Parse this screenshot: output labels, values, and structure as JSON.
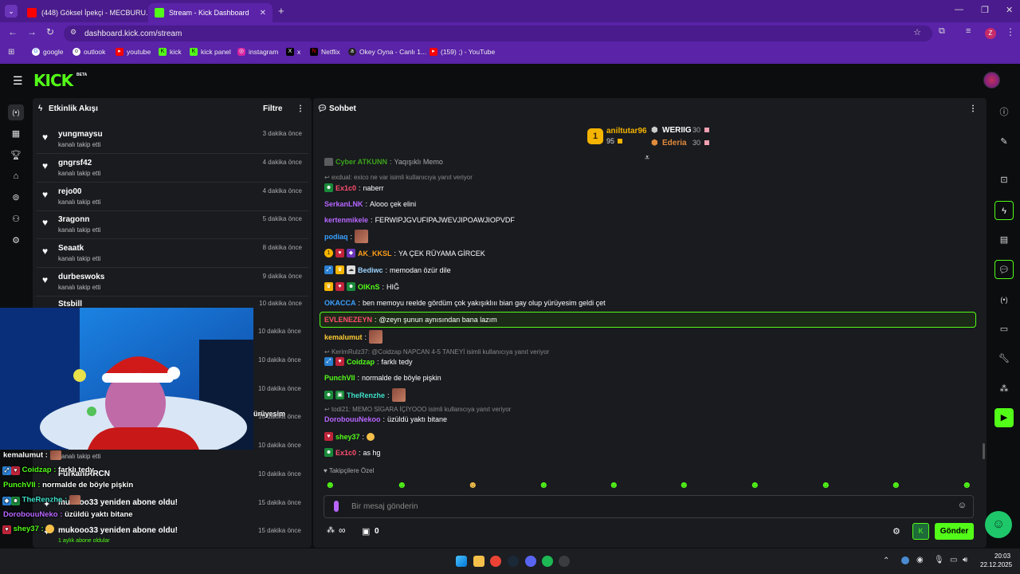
{
  "browser": {
    "tabs": [
      {
        "title": "(448) Göksel İpekçi - MECBURU..."
      },
      {
        "title": "Stream - Kick Dashboard"
      }
    ],
    "new_tab": "+",
    "url": "dashboard.kick.com/stream",
    "profile_letter": "Z",
    "bookmarks": [
      "google",
      "outlook",
      "youtube",
      "kick",
      "kick panel",
      "instagram",
      "x",
      "Netflix",
      "Okey Oyna - Canlı 1...",
      "(159) ;) - YouTube"
    ]
  },
  "kick": {
    "logo": "KICK",
    "beta": "BETA"
  },
  "activity": {
    "title": "Etkinlik Akışı",
    "filter": "Filtre",
    "items": [
      {
        "name": "yungmaysu",
        "action": "kanalı takip etti",
        "time": "3 dakika önce"
      },
      {
        "name": "gngrsf42",
        "action": "kanalı takip etti",
        "time": "4 dakika önce"
      },
      {
        "name": "rejo00",
        "action": "kanalı takip etti",
        "time": "4 dakika önce"
      },
      {
        "name": "3ragonn",
        "action": "kanalı takip etti",
        "time": "5 dakika önce"
      },
      {
        "name": "Seaatk",
        "action": "kanalı takip etti",
        "time": "8 dakika önce"
      },
      {
        "name": "durbeswoks",
        "action": "kanalı takip etti",
        "time": "9 dakika önce"
      },
      {
        "name": "Stsbill",
        "action": "",
        "time": "10 dakika önce"
      }
    ],
    "hidden_times": [
      "10 dakika önce",
      "10 dakika önce",
      "10 dakika önce",
      "10 dakika önce",
      "10 dakika önce"
    ],
    "partial_text": "ürüyesim",
    "follow_tail": "kanalı takip etti",
    "furkan": "FurkanIARCN",
    "subs": [
      {
        "name": "mukooo33 yeniden abone oldu!",
        "time": "15 dakika önce"
      },
      {
        "name": "mukooo33 yeniden abone oldu!",
        "time": "15 dakika önce"
      }
    ],
    "sub_tail": "1 aylık abone oldular"
  },
  "overlay_chat": [
    {
      "user": "kemalumut",
      "text": "",
      "color": "#ffffff"
    },
    {
      "user": "Coidzap",
      "text": "farklı tedy",
      "color": "#53fc18"
    },
    {
      "user": "PunchVII",
      "text": "normalde de böyle pişkin",
      "color": "#53fc18"
    },
    {
      "user": "TheRenzhe",
      "text": "",
      "color": "#3ee0c8"
    },
    {
      "user": "DorobouuNeko",
      "text": "üzüldü yaktı bitane",
      "color": "#b866ff"
    },
    {
      "user": "shey37",
      "text": "",
      "color": "#53fc18"
    }
  ],
  "chat": {
    "title": "Sohbet",
    "leaderboard": {
      "first": {
        "rank": "1",
        "name": "aniltutar96",
        "points": "95"
      },
      "second": {
        "name": "WERIIG",
        "points": "30"
      },
      "third": {
        "name": "Ederia",
        "points": "30"
      }
    },
    "messages": [
      {
        "user": "Cyber ATKUNN",
        "text": "Yaqışıklı Memo",
        "color": "#53fc18",
        "reply": ""
      },
      {
        "user": "Ex1c0",
        "text": "naberr",
        "color": "#ff4d6d",
        "reply": "exdual: exico ne var isimli kullanıcıya yanıt veriyor"
      },
      {
        "user": "SerkanLNK",
        "text": "Alooo çek elini",
        "color": "#b866ff",
        "reply": ""
      },
      {
        "user": "kertenmikele",
        "text": "FERWIPJGVUFIPAJWEVJIPOAWJIOPVDF",
        "color": "#b866ff",
        "reply": ""
      },
      {
        "user": "podiaq",
        "text": "",
        "color": "#3aa0ff",
        "reply": ""
      },
      {
        "user": "AK_KKSL",
        "text": "YA ÇEK RÜYAMA GİRCEK",
        "color": "#ff9f1a",
        "reply": ""
      },
      {
        "user": "Bediwc",
        "text": "memodan özür dile",
        "color": "#9fd4ff",
        "reply": ""
      },
      {
        "user": "OlKnS",
        "text": "HIĞ",
        "color": "#53fc18",
        "reply": ""
      },
      {
        "user": "OKACCA",
        "text": "ben memoyu reelde gördüm çok yakışıklııı bian gay olup yürüyesim geldi çet",
        "color": "#3aa0ff",
        "reply": ""
      },
      {
        "user": "EVLENEZEYN",
        "text": "@zeyn şunun aynısından bana lazım",
        "color": "#ff4d6d",
        "reply": ""
      },
      {
        "user": "kemalumut",
        "text": "",
        "color": "#ffcc33",
        "reply": ""
      },
      {
        "user": "Coidzap",
        "text": "farklı tedy",
        "color": "#53fc18",
        "reply": "KerimRulz37: @Coidzap NAPCAN 4-5 TANEYİ isimli kullanıcıya yanıt veriyor"
      },
      {
        "user": "PunchVII",
        "text": "normalde de böyle pişkin",
        "color": "#53fc18",
        "reply": ""
      },
      {
        "user": "TheRenzhe",
        "text": "",
        "color": "#3ee0c8",
        "reply": ""
      },
      {
        "user": "DorobouuNekoo",
        "text": "üzüldü yaktı bitane",
        "color": "#b866ff",
        "reply": "todi21: MEMO SİGARA İÇİYOOO isimli kullanıcıya yanıt veriyor"
      },
      {
        "user": "shey37",
        "text": "",
        "color": "#53fc18",
        "reply": ""
      },
      {
        "user": "Ex1c0",
        "text": "as hg",
        "color": "#ff4d6d",
        "reply": ""
      }
    ],
    "followers_only": "Takipçilere Özel",
    "input_placeholder": "Bir mesaj gönderin",
    "infinity": "∞",
    "box_count": "0",
    "send": "Gönder"
  },
  "taskbar": {
    "time": "20:03",
    "date": "22.12.2025"
  },
  "colors": {
    "accent": "#53fc18",
    "browser_purple": "#5a23a8"
  }
}
